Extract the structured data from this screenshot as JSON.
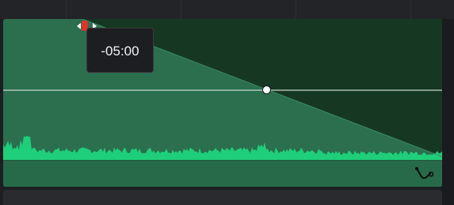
{
  "timeline": {
    "fade_tooltip": "-05:00"
  },
  "colors": {
    "clip_background": "#2b6f4e",
    "faded_region": "#163822",
    "waveform": "#1fce7a",
    "volume_line": "#c9d6cf",
    "keyframe": "#ffffff",
    "fade_handle": "#d8352b",
    "tooltip_background": "#1d1e22",
    "tooltip_text": "#f2f2f2"
  },
  "icons": {
    "fade_handle": "fade-handle-icon",
    "keyframe": "keyframe-icon",
    "curve": "curve-icon"
  }
}
